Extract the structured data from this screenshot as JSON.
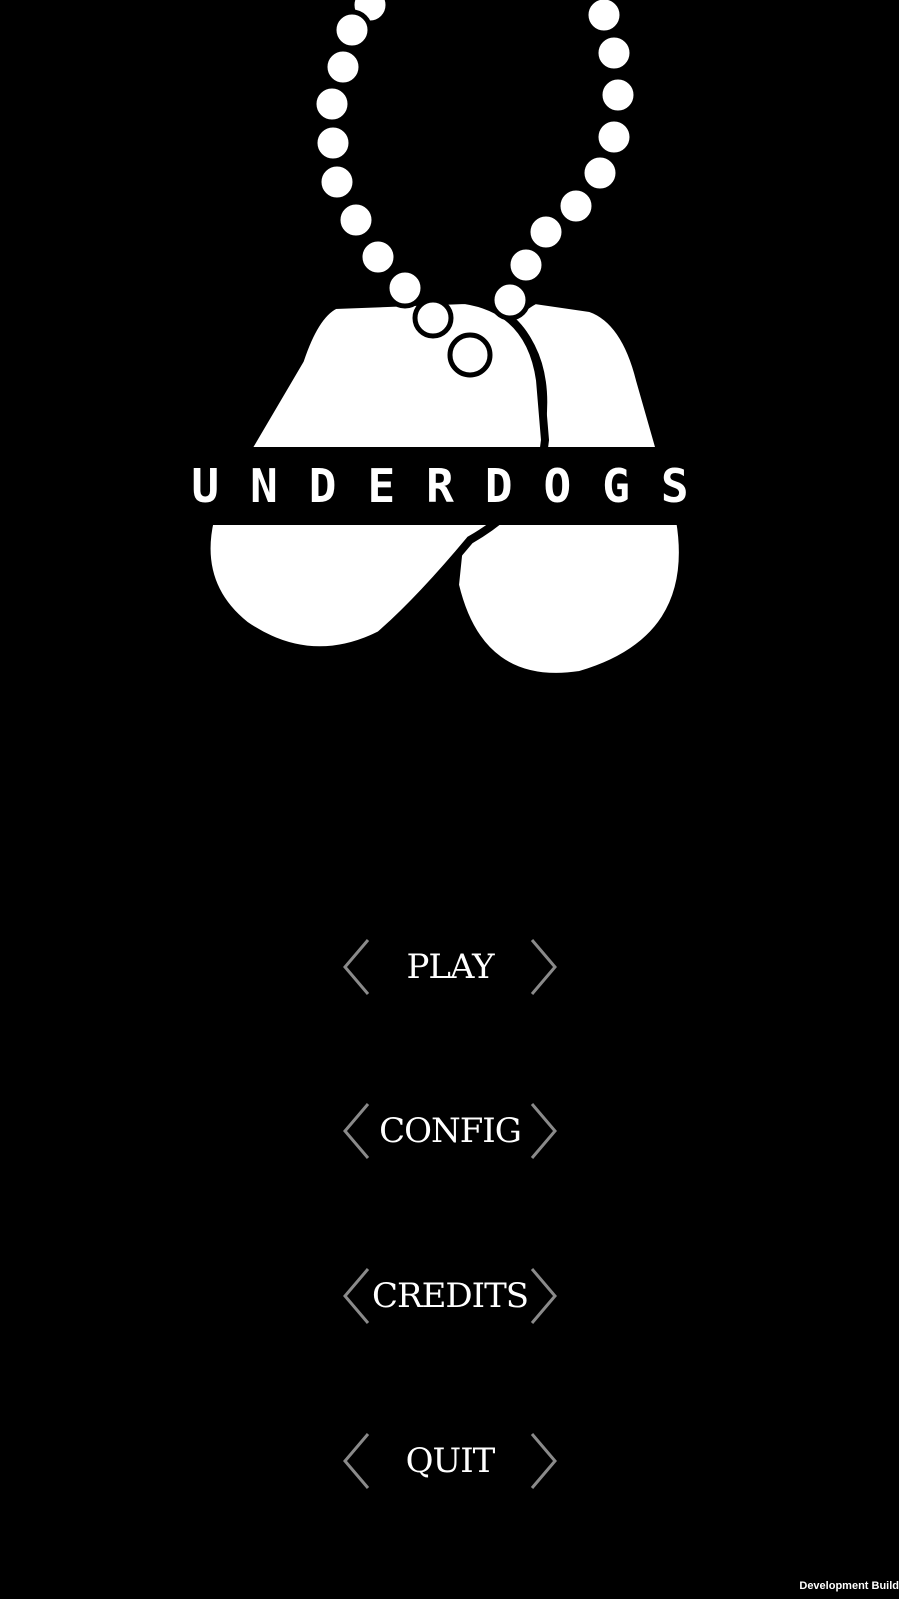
{
  "game": {
    "title": "UNDERDOGS"
  },
  "main_menu": {
    "items": [
      {
        "id": "play",
        "label": "PLAY"
      },
      {
        "id": "config",
        "label": "CONFIG"
      },
      {
        "id": "credits",
        "label": "CREDITS"
      },
      {
        "id": "quit",
        "label": "QUIT"
      }
    ]
  },
  "footer": {
    "build_label": "Development Build"
  },
  "colors": {
    "background": "#000000",
    "foreground": "#ffffff",
    "chevron": "#8a8a8a"
  },
  "icons": {
    "logo": "dog-tags-icon",
    "menu_arrows": [
      "chevron-left-icon",
      "chevron-right-icon"
    ]
  }
}
